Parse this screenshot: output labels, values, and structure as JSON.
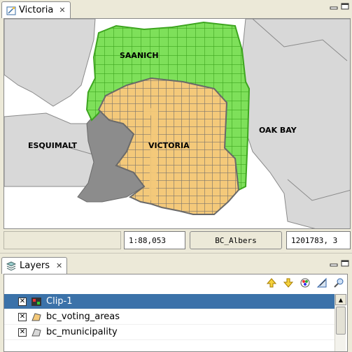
{
  "map_view": {
    "tab_title": "Victoria",
    "labels": {
      "saanich": "SAANICH",
      "esquimalt": "ESQUIMALT",
      "victoria": "VICTORIA",
      "oak_bay": "OAK BAY"
    },
    "status": {
      "scale": "1:88,053",
      "crs": "BC_Albers",
      "coordinates": "1201783, 3"
    },
    "colors": {
      "voting_areas": "#f4c97a",
      "clip_green": "#7ee05a",
      "municipality": "#d8d8d8",
      "outline": "#6a6a6a"
    }
  },
  "layers_panel": {
    "tab_title": "Layers",
    "layers": [
      {
        "name": "Clip-1",
        "checked": true,
        "selected": true,
        "icon": "clip-layer-icon"
      },
      {
        "name": "bc_voting_areas",
        "checked": true,
        "selected": false,
        "icon": "polygon-layer-icon"
      },
      {
        "name": "bc_municipality",
        "checked": true,
        "selected": false,
        "icon": "polygon-layer-icon"
      }
    ],
    "toolbar_icons": [
      "move-up-icon",
      "move-down-icon",
      "style-icon",
      "edit-icon",
      "zoom-layer-icon"
    ]
  }
}
